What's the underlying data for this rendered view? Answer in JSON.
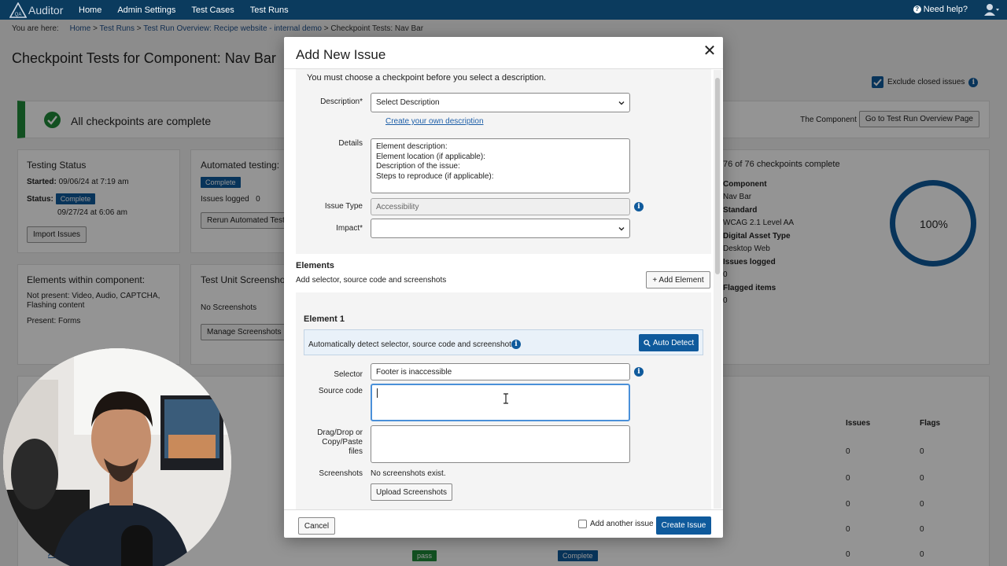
{
  "topnav": {
    "brand": "Auditor",
    "links": [
      "Home",
      "Admin Settings",
      "Test Cases",
      "Test Runs"
    ],
    "help": "Need help?"
  },
  "breadcrumb": {
    "prefix": "You are here:",
    "items": [
      "Home",
      "Test Runs",
      "Test Run Overview: Recipe website - internal demo"
    ],
    "current": "Checkpoint Tests: Nav Bar",
    "sep": ">"
  },
  "page": {
    "title": "Checkpoint Tests for Component: Nav Bar",
    "exclude_closed": "Exclude closed issues",
    "banner": "All checkpoints are complete",
    "banner_right": "The Component is complete.",
    "goto_button": "Go to Test Run Overview Page"
  },
  "testing_status": {
    "title": "Testing Status",
    "started_label": "Started:",
    "started": "09/06/24 at 7:19 am",
    "status_label": "Status:",
    "status": "Complete",
    "completed": "09/27/24 at 6:06 am",
    "import_button": "Import Issues"
  },
  "automated": {
    "title": "Automated testing:",
    "status": "Complete",
    "issues_logged": "Issues logged",
    "issues_count": "0",
    "rerun_button": "Rerun Automated Tests"
  },
  "elements_within": {
    "title": "Elements within component:",
    "not_present": "Not present: Video, Audio, CAPTCHA, Flashing content",
    "present": "Present: Forms"
  },
  "screenshots_card": {
    "title": "Test Unit Screenshots",
    "none": "No Screenshots",
    "manage_button": "Manage Screenshots"
  },
  "summary": {
    "checkpoints": "76 of 76 checkpoints complete",
    "component_label": "Component",
    "component": "Nav Bar",
    "standard_label": "Standard",
    "standard": "WCAG 2.1 Level AA",
    "asset_label": "Digital Asset Type",
    "asset": "Desktop Web",
    "issues_label": "Issues logged",
    "issues": "0",
    "flagged_label": "Flagged items",
    "flagged": "0",
    "percent": "100%"
  },
  "table": {
    "headers": [
      "Issues",
      "Flags"
    ],
    "rows": [
      [
        "0",
        "0"
      ],
      [
        "0",
        "0"
      ],
      [
        "0",
        "0"
      ],
      [
        "0",
        "0"
      ],
      [
        "0",
        "0"
      ]
    ],
    "last_row": {
      "link": "Alter",
      "result": "pass",
      "status": "Complete"
    }
  },
  "modal": {
    "title": "Add New Issue",
    "note": "You must choose a checkpoint before you select a description.",
    "description_label": "Description*",
    "description_value": "Select Description",
    "create_own": "Create your own description",
    "details_label": "Details",
    "details_lines": [
      "Element description:",
      "Element location (if applicable):",
      "Description of the issue:",
      "Steps to reproduce (if applicable):"
    ],
    "issue_type_label": "Issue Type",
    "issue_type_value": "Accessibility",
    "impact_label": "Impact*",
    "impact_value": "",
    "elements_heading": "Elements",
    "elements_sub": "Add selector, source code and screenshots",
    "add_element": "+ Add Element",
    "element_title": "Element 1",
    "auto_text": "Automatically detect selector, source code and screenshots",
    "auto_button": "Auto Detect",
    "selector_label": "Selector",
    "selector_value": "Footer is inaccessible",
    "source_label": "Source code",
    "source_value": "",
    "drag_label_1": "Drag/Drop or",
    "drag_label_2": "Copy/Paste files",
    "screenshots_label": "Screenshots",
    "screenshots_value": "No screenshots exist.",
    "upload_button": "Upload Screenshots",
    "cancel_button": "Cancel",
    "add_another": "Add another issue",
    "create_button": "Create Issue"
  },
  "colors": {
    "nav": "#0b3b5e",
    "primary": "#0f5a9c",
    "success": "#1f8a3a"
  }
}
